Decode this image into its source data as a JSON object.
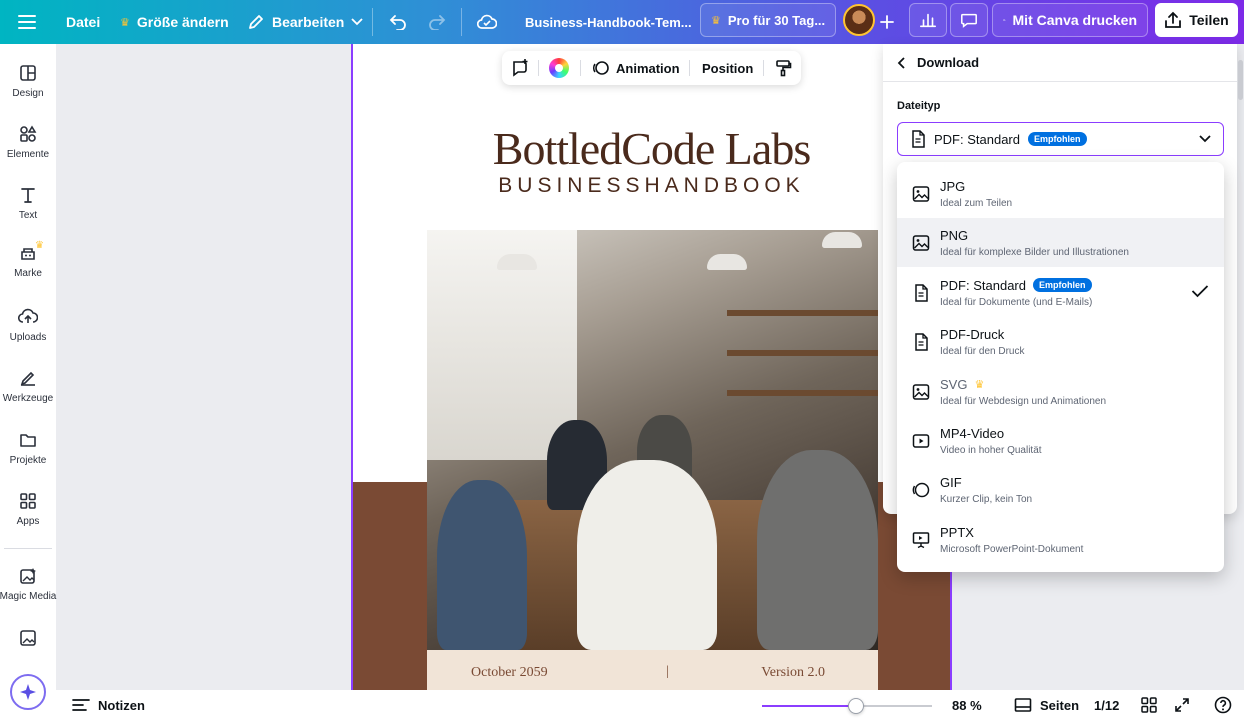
{
  "topbar": {
    "file_menu": "Datei",
    "resize": "Größe ändern",
    "edit": "Bearbeiten",
    "doc_title": "Business-Handbook-Tem...",
    "pro_trial": "Pro für 30 Tag...",
    "print": "Mit Canva drucken",
    "share": "Teilen"
  },
  "sidebar": {
    "items": [
      {
        "label": "Design",
        "icon": "layout-icon"
      },
      {
        "label": "Elemente",
        "icon": "shapes-icon"
      },
      {
        "label": "Text",
        "icon": "text-icon"
      },
      {
        "label": "Marke",
        "icon": "brand-icon"
      },
      {
        "label": "Uploads",
        "icon": "upload-cloud-icon"
      },
      {
        "label": "Werkzeuge",
        "icon": "pen-icon"
      },
      {
        "label": "Projekte",
        "icon": "folder-icon"
      },
      {
        "label": "Apps",
        "icon": "apps-grid-icon"
      },
      {
        "label": "Magic Media",
        "icon": "magic-image-icon"
      }
    ]
  },
  "canvas": {
    "toolbar": {
      "animation": "Animation",
      "position": "Position"
    },
    "document": {
      "title": "BottledCode Labs",
      "subtitle": "BUSINESSHANDBOOK",
      "footer_left": "October 2059",
      "footer_separator": "|",
      "footer_right": "Version 2.0"
    }
  },
  "download_panel": {
    "back_label": "Download",
    "filetype_label": "Dateityp",
    "selected": "PDF: Standard",
    "recommended_badge": "Empfohlen",
    "options": [
      {
        "title": "JPG",
        "desc": "Ideal zum Teilen",
        "icon": "image-icon"
      },
      {
        "title": "PNG",
        "desc": "Ideal für komplexe Bilder und Illustrationen",
        "icon": "image-icon"
      },
      {
        "title": "PDF: Standard",
        "desc": "Ideal für Dokumente (und E-Mails)",
        "icon": "document-icon",
        "badge": "Empfohlen",
        "selected": true
      },
      {
        "title": "PDF-Druck",
        "desc": "Ideal für den Druck",
        "icon": "document-icon"
      },
      {
        "title": "SVG",
        "desc": "Ideal für Webdesign und Animationen",
        "icon": "image-icon",
        "pro": true
      },
      {
        "title": "MP4-Video",
        "desc": "Video in hoher Qualität",
        "icon": "video-icon"
      },
      {
        "title": "GIF",
        "desc": "Kurzer Clip, kein Ton",
        "icon": "gif-icon"
      },
      {
        "title": "PPTX",
        "desc": "Microsoft PowerPoint-Dokument",
        "icon": "presentation-icon"
      }
    ]
  },
  "bottombar": {
    "notes": "Notizen",
    "zoom": "88 %",
    "zoom_value": 0.55,
    "pages": "Seiten",
    "page_counter": "1/12"
  },
  "colors": {
    "accent": "#8b3dff",
    "brand_brown": "#7a4a34",
    "recommended_blue": "#0070e0",
    "crown": "#ffc431"
  }
}
